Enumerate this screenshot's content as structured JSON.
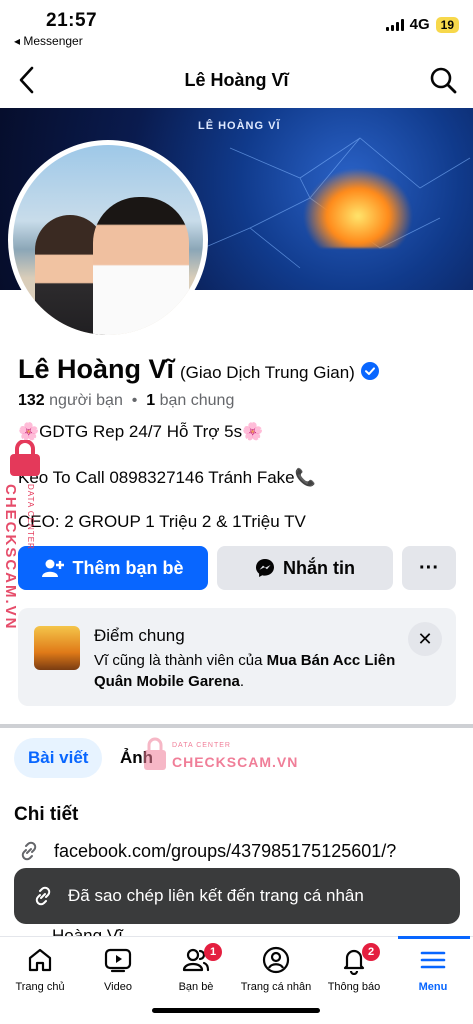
{
  "status_bar": {
    "time": "21:57",
    "back_app": "◂ Messenger",
    "network": "4G",
    "battery": "19"
  },
  "nav": {
    "title": "Lê Hoàng Vĩ"
  },
  "cover": {
    "logo_text": "LÊ HOÀNG VĨ"
  },
  "profile": {
    "name": "Lê Hoàng Vĩ",
    "name_suffix": "(Giao Dịch Trung Gian)",
    "friends_count": "132",
    "friends_label": "người bạn",
    "mutual_count": "1",
    "mutual_label": "bạn chung",
    "bio_lines": [
      "🌸GDTG Rep 24/7 Hỗ Trợ 5s🌸",
      "Keo To Call 0898327146 Tránh Fake📞",
      "CEO: 2 GROUP 1 Triệu 2 & 1Triệu TV"
    ]
  },
  "actions": {
    "add_friend": "Thêm bạn bè",
    "message": "Nhắn tin",
    "more": "···"
  },
  "mutual_card": {
    "title": "Điểm chung",
    "text_prefix": "Vĩ cũng là thành viên của ",
    "group_name": "Mua Bán Acc Liên Quân Mobile Garena",
    "text_suffix": "."
  },
  "tabs": {
    "posts": "Bài viết",
    "photos": "Ảnh"
  },
  "details": {
    "title": "Chi tiết",
    "link": "facebook.com/groups/437985175125601/?",
    "below": "Hoàng Vĩ"
  },
  "toast": {
    "text": "Đã sao chép liên kết đến trang cá nhân"
  },
  "watermark": {
    "brand": "CHECKSCAM.VN",
    "sub": "DATA CENTER"
  },
  "bottom_nav": [
    {
      "label": "Trang chủ",
      "icon": "home-icon"
    },
    {
      "label": "Video",
      "icon": "video-icon"
    },
    {
      "label": "Bạn bè",
      "icon": "friends-icon",
      "badge": "1"
    },
    {
      "label": "Trang cá nhân",
      "icon": "profile-icon"
    },
    {
      "label": "Thông báo",
      "icon": "bell-icon",
      "badge": "2"
    },
    {
      "label": "Menu",
      "icon": "menu-icon"
    }
  ],
  "colors": {
    "accent": "#0866ff",
    "badge": "#e41e3f",
    "verified": "#0866ff",
    "watermark": "#e4395a"
  }
}
